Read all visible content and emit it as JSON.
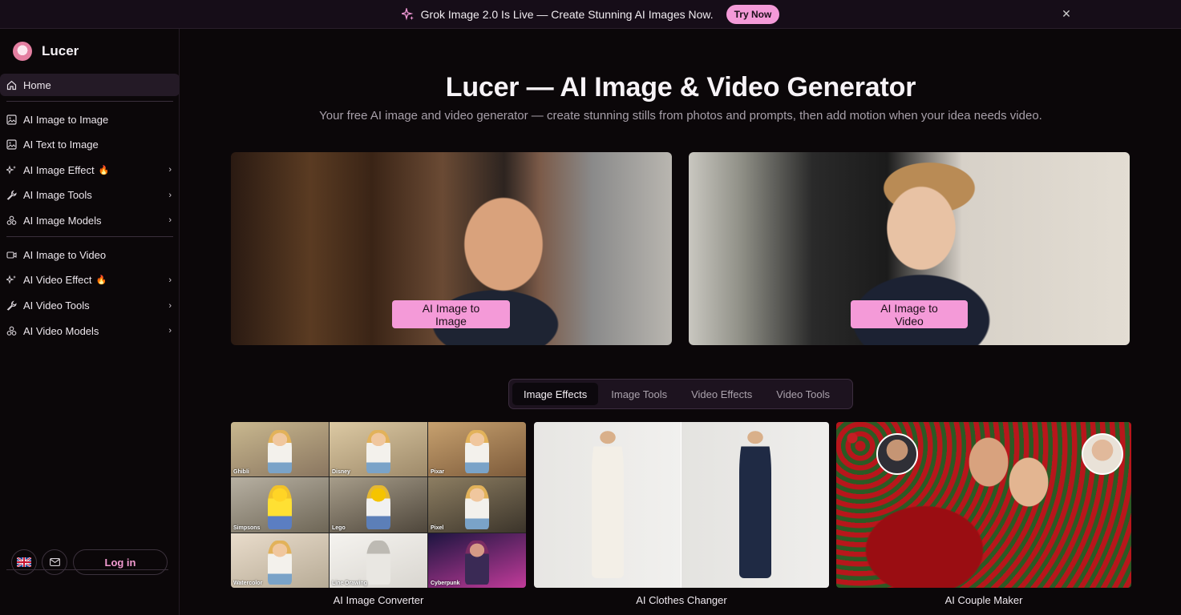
{
  "banner": {
    "icon": "sparkle-icon",
    "text": "Grok Image 2.0 Is Live — Create Stunning AI Images Now.",
    "cta": "Try Now",
    "close": "close-icon"
  },
  "brand": {
    "name": "Lucer"
  },
  "sidebar": {
    "items": [
      {
        "label": "Home",
        "icon": "home-icon",
        "active": true
      },
      {
        "label": "AI Image to Image",
        "icon": "image-icon"
      },
      {
        "label": "AI Text to Image",
        "icon": "image-icon"
      },
      {
        "label": "AI Image Effect",
        "icon": "sparkles-icon",
        "hot": true,
        "chevron": true
      },
      {
        "label": "AI Image Tools",
        "icon": "wrench-icon",
        "chevron": true
      },
      {
        "label": "AI Image Models",
        "icon": "cubes-icon",
        "chevron": true
      },
      {
        "label": "AI Image to Video",
        "icon": "video-icon"
      },
      {
        "label": "AI Video Effect",
        "icon": "sparkles-icon",
        "hot": true,
        "chevron": true
      },
      {
        "label": "AI Video Tools",
        "icon": "wrench-icon",
        "chevron": true
      },
      {
        "label": "AI Video Models",
        "icon": "cubes-icon",
        "chevron": true
      }
    ],
    "login": "Log in"
  },
  "hero": {
    "title": "Lucer — AI Image & Video Generator",
    "subtitle": "Your free AI image and video generator — create stunning stills from photos and prompts, then add motion when your idea needs video.",
    "cards": [
      {
        "button": "AI Image to Image"
      },
      {
        "button": "AI Image to Video"
      }
    ]
  },
  "tabs": [
    {
      "label": "Image Effects",
      "active": true
    },
    {
      "label": "Image Tools"
    },
    {
      "label": "Video Effects"
    },
    {
      "label": "Video Tools"
    }
  ],
  "effects": {
    "converter_styles": [
      "Ghibli",
      "Disney",
      "Pixar",
      "Simpsons",
      "Lego",
      "Pixel",
      "Watercolor",
      "Line Drawing",
      "Cyberpunk"
    ],
    "cards": [
      {
        "title": "AI Image Converter"
      },
      {
        "title": "AI Clothes Changer"
      },
      {
        "title": "AI Couple Maker"
      }
    ]
  },
  "colors": {
    "accent": "#f49ad8",
    "background": "#0b0709",
    "hot": "#ff4d3a"
  }
}
